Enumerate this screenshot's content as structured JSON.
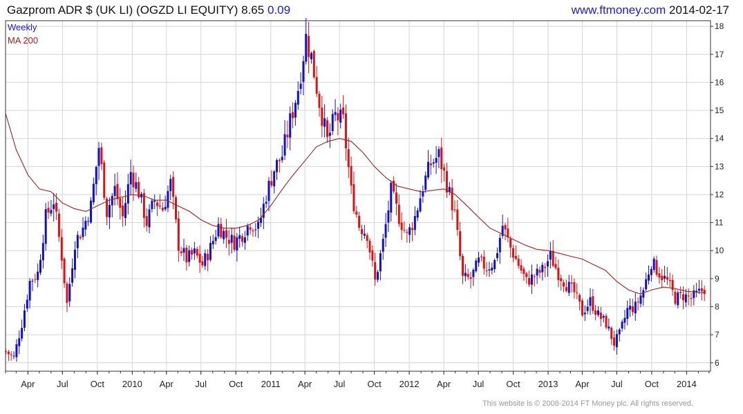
{
  "header": {
    "instrument": "Gazprom ADR $ (UK LI) (OGZD LI EQUITY) 8.65",
    "change": "0.09",
    "site": "www.ftmoney.com",
    "date": "2014-02-17"
  },
  "footer": {
    "copyright": "This website is © 2008-2014 FT Money plc. All rights reserved."
  },
  "colors": {
    "up": "#1010c8",
    "down": "#e01010",
    "ma": "#9b2222",
    "grid": "#d4d4d4"
  },
  "chart_data": {
    "type": "candlestick",
    "legend": [
      {
        "name": "Weekly",
        "color": "#1a1ae6"
      },
      {
        "name": "MA 200",
        "color": "#9b2222"
      }
    ],
    "legend_position": "top-left",
    "grid": true,
    "ylim": [
      5.7,
      18.2
    ],
    "y_ticks": [
      6,
      7,
      8,
      9,
      10,
      11,
      12,
      13,
      14,
      15,
      16,
      17,
      18
    ],
    "xlim": [
      "2009-02-01",
      "2014-03-05"
    ],
    "x_ticks": [
      {
        "date": "2009-04-01",
        "label": "Apr"
      },
      {
        "date": "2009-07-01",
        "label": "Jul"
      },
      {
        "date": "2009-10-01",
        "label": "Oct"
      },
      {
        "date": "2010-01-01",
        "label": "2010"
      },
      {
        "date": "2010-04-01",
        "label": "Apr"
      },
      {
        "date": "2010-07-01",
        "label": "Jul"
      },
      {
        "date": "2010-10-01",
        "label": "Oct"
      },
      {
        "date": "2011-01-01",
        "label": "2011"
      },
      {
        "date": "2011-04-01",
        "label": "Apr"
      },
      {
        "date": "2011-07-01",
        "label": "Jul"
      },
      {
        "date": "2011-10-01",
        "label": "Oct"
      },
      {
        "date": "2012-01-01",
        "label": "2012"
      },
      {
        "date": "2012-04-01",
        "label": "Apr"
      },
      {
        "date": "2012-07-01",
        "label": "Jul"
      },
      {
        "date": "2012-10-01",
        "label": "Oct"
      },
      {
        "date": "2013-01-01",
        "label": "2013"
      },
      {
        "date": "2013-04-01",
        "label": "Apr"
      },
      {
        "date": "2013-07-01",
        "label": "Jul"
      },
      {
        "date": "2013-10-01",
        "label": "Oct"
      },
      {
        "date": "2014-01-01",
        "label": "2014"
      }
    ],
    "price_close_path": [
      [
        "2009-02-02",
        6.4
      ],
      [
        "2009-02-23",
        6.2
      ],
      [
        "2009-03-16",
        7.4
      ],
      [
        "2009-04-06",
        8.9
      ],
      [
        "2009-04-27",
        9.2
      ],
      [
        "2009-05-18",
        11.2
      ],
      [
        "2009-06-08",
        11.8
      ],
      [
        "2009-06-29",
        9.8
      ],
      [
        "2009-07-13",
        8.1
      ],
      [
        "2009-08-03",
        10.3
      ],
      [
        "2009-08-24",
        10.8
      ],
      [
        "2009-09-14",
        11.6
      ],
      [
        "2009-10-05",
        13.7
      ],
      [
        "2009-10-26",
        11.4
      ],
      [
        "2009-11-16",
        12.2
      ],
      [
        "2009-12-07",
        11.2
      ],
      [
        "2009-12-28",
        12.8
      ],
      [
        "2010-01-18",
        12.1
      ],
      [
        "2010-02-08",
        11.0
      ],
      [
        "2010-03-01",
        11.8
      ],
      [
        "2010-03-22",
        11.5
      ],
      [
        "2010-04-12",
        12.4
      ],
      [
        "2010-05-03",
        10.2
      ],
      [
        "2010-05-24",
        9.7
      ],
      [
        "2010-06-14",
        9.9
      ],
      [
        "2010-07-05",
        9.5
      ],
      [
        "2010-07-26",
        10.1
      ],
      [
        "2010-08-16",
        10.9
      ],
      [
        "2010-09-06",
        10.5
      ],
      [
        "2010-09-27",
        10.3
      ],
      [
        "2010-10-18",
        10.6
      ],
      [
        "2010-11-08",
        11.0
      ],
      [
        "2010-11-29",
        10.8
      ],
      [
        "2010-12-20",
        12.0
      ],
      [
        "2011-01-10",
        12.9
      ],
      [
        "2011-01-31",
        13.4
      ],
      [
        "2011-02-21",
        14.6
      ],
      [
        "2011-03-14",
        15.8
      ],
      [
        "2011-04-04",
        17.6
      ],
      [
        "2011-04-18",
        16.9
      ],
      [
        "2011-05-09",
        15.3
      ],
      [
        "2011-05-30",
        13.9
      ],
      [
        "2011-06-20",
        14.8
      ],
      [
        "2011-07-11",
        14.6
      ],
      [
        "2011-08-01",
        12.1
      ],
      [
        "2011-08-22",
        10.9
      ],
      [
        "2011-09-12",
        10.6
      ],
      [
        "2011-10-03",
        8.9
      ],
      [
        "2011-10-24",
        10.3
      ],
      [
        "2011-11-14",
        12.1
      ],
      [
        "2011-12-05",
        11.2
      ],
      [
        "2011-12-26",
        10.5
      ],
      [
        "2012-01-16",
        11.2
      ],
      [
        "2012-02-06",
        12.3
      ],
      [
        "2012-02-27",
        13.1
      ],
      [
        "2012-03-19",
        13.4
      ],
      [
        "2012-04-09",
        12.4
      ],
      [
        "2012-04-30",
        11.3
      ],
      [
        "2012-05-21",
        9.0
      ],
      [
        "2012-06-11",
        9.0
      ],
      [
        "2012-07-02",
        9.6
      ],
      [
        "2012-07-23",
        9.4
      ],
      [
        "2012-08-13",
        9.6
      ],
      [
        "2012-09-03",
        10.9
      ],
      [
        "2012-09-24",
        10.1
      ],
      [
        "2012-10-15",
        9.5
      ],
      [
        "2012-11-05",
        8.9
      ],
      [
        "2012-11-26",
        9.1
      ],
      [
        "2012-12-17",
        9.3
      ],
      [
        "2013-01-07",
        9.8
      ],
      [
        "2013-01-28",
        9.2
      ],
      [
        "2013-02-18",
        8.8
      ],
      [
        "2013-03-11",
        8.5
      ],
      [
        "2013-04-01",
        7.8
      ],
      [
        "2013-04-22",
        8.2
      ],
      [
        "2013-05-13",
        7.7
      ],
      [
        "2013-06-03",
        7.4
      ],
      [
        "2013-06-24",
        6.7
      ],
      [
        "2013-07-08",
        7.0
      ],
      [
        "2013-07-29",
        7.9
      ],
      [
        "2013-08-19",
        8.0
      ],
      [
        "2013-09-09",
        8.6
      ],
      [
        "2013-09-30",
        9.6
      ],
      [
        "2013-10-21",
        9.2
      ],
      [
        "2013-11-11",
        8.9
      ],
      [
        "2013-12-02",
        8.3
      ],
      [
        "2013-12-23",
        8.4
      ],
      [
        "2014-01-13",
        8.3
      ],
      [
        "2014-02-03",
        8.5
      ],
      [
        "2014-02-17",
        8.65
      ]
    ],
    "ma200": [
      [
        "2009-02-01",
        14.9
      ],
      [
        "2009-03-01",
        13.6
      ],
      [
        "2009-04-01",
        12.7
      ],
      [
        "2009-05-01",
        12.2
      ],
      [
        "2009-06-01",
        12.1
      ],
      [
        "2009-07-01",
        11.7
      ],
      [
        "2009-08-01",
        11.5
      ],
      [
        "2009-09-01",
        11.4
      ],
      [
        "2009-10-01",
        11.6
      ],
      [
        "2009-11-01",
        11.8
      ],
      [
        "2009-12-01",
        11.9
      ],
      [
        "2010-01-01",
        12.0
      ],
      [
        "2010-02-01",
        11.95
      ],
      [
        "2010-03-01",
        11.8
      ],
      [
        "2010-04-01",
        11.8
      ],
      [
        "2010-05-01",
        11.6
      ],
      [
        "2010-06-01",
        11.4
      ],
      [
        "2010-07-01",
        11.1
      ],
      [
        "2010-08-01",
        10.9
      ],
      [
        "2010-09-01",
        10.8
      ],
      [
        "2010-10-01",
        10.8
      ],
      [
        "2010-11-01",
        10.9
      ],
      [
        "2010-12-01",
        11.1
      ],
      [
        "2011-01-01",
        11.6
      ],
      [
        "2011-02-01",
        12.2
      ],
      [
        "2011-03-01",
        12.7
      ],
      [
        "2011-04-01",
        13.2
      ],
      [
        "2011-05-01",
        13.7
      ],
      [
        "2011-06-01",
        13.9
      ],
      [
        "2011-07-01",
        14.0
      ],
      [
        "2011-08-01",
        13.9
      ],
      [
        "2011-09-01",
        13.5
      ],
      [
        "2011-10-01",
        13.0
      ],
      [
        "2011-11-01",
        12.6
      ],
      [
        "2011-12-01",
        12.3
      ],
      [
        "2012-01-01",
        12.2
      ],
      [
        "2012-02-01",
        12.1
      ],
      [
        "2012-03-01",
        12.15
      ],
      [
        "2012-04-01",
        12.2
      ],
      [
        "2012-05-01",
        12.0
      ],
      [
        "2012-06-01",
        11.6
      ],
      [
        "2012-07-01",
        11.2
      ],
      [
        "2012-08-01",
        10.8
      ],
      [
        "2012-09-01",
        10.6
      ],
      [
        "2012-10-01",
        10.4
      ],
      [
        "2012-11-01",
        10.2
      ],
      [
        "2012-12-01",
        10.05
      ],
      [
        "2013-01-01",
        10.0
      ],
      [
        "2013-02-01",
        9.9
      ],
      [
        "2013-03-01",
        9.8
      ],
      [
        "2013-04-01",
        9.7
      ],
      [
        "2013-05-01",
        9.5
      ],
      [
        "2013-06-01",
        9.3
      ],
      [
        "2013-07-01",
        8.9
      ],
      [
        "2013-08-01",
        8.6
      ],
      [
        "2013-09-01",
        8.45
      ],
      [
        "2013-10-01",
        8.6
      ],
      [
        "2013-11-01",
        8.7
      ],
      [
        "2013-12-01",
        8.65
      ],
      [
        "2014-01-01",
        8.55
      ],
      [
        "2014-02-17",
        8.5
      ]
    ]
  }
}
